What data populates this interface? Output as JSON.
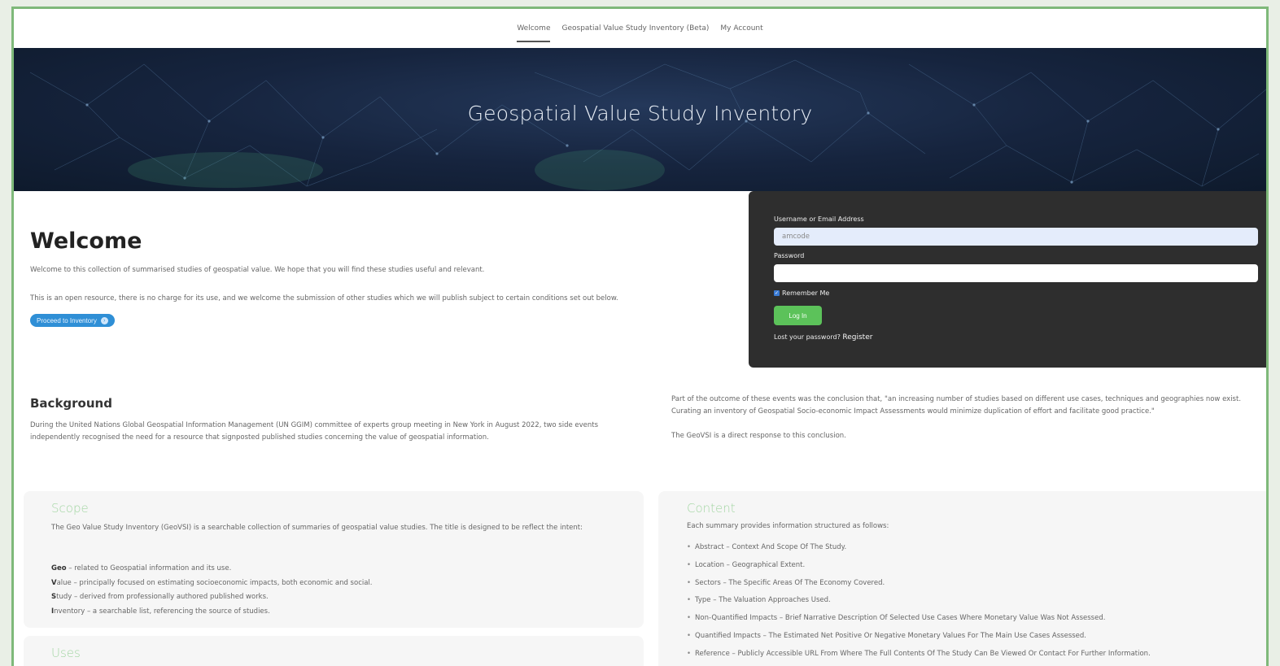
{
  "nav": {
    "items": [
      "Welcome",
      "Geospatial Value Study Inventory (Beta)",
      "My Account"
    ],
    "active": "Welcome"
  },
  "hero": {
    "title": "Geospatial Value Study Inventory"
  },
  "welcome": {
    "title": "Welcome",
    "p1": "Welcome to this collection of summarised studies of geospatial value. We hope that you will find these studies useful and relevant.",
    "p2": "This is an open resource, there is no charge for its use, and we welcome the submission of other studies which we will publish subject to certain conditions set out below.",
    "proceed_label": "Proceed to Inventory",
    "proceed_icon": "arrow-circle-icon"
  },
  "login": {
    "username_label": "Username or Email Address",
    "username_value": "amcode",
    "password_label": "Password",
    "remember_label": "Remember Me",
    "remember_checked": true,
    "submit_label": "Log In",
    "lost_label": "Lost your password?",
    "register_label": "Register"
  },
  "background": {
    "title": "Background",
    "text": "During the United Nations Global Geospatial Information Management (UN GGIM) committee of experts group meeting in New York in August 2022, two side events independently recognised the need for a resource that signposted published studies concerning the value of geospatial information.",
    "right_text": "Part of the outcome of these events was the conclusion that, \"an increasing number of studies based on different use cases, techniques and geographies now exist. Curating an inventory of Geospatial Socio-economic Impact Assessments would minimize duplication of effort and facilitate good practice.\"",
    "right_text2": "The GeoVSI is a direct response to this conclusion."
  },
  "scope": {
    "title": "Scope",
    "text": "The Geo Value Study Inventory (GeoVSI) is a searchable collection of summaries of geospatial value studies.  The title is designed to be reflect the intent:",
    "items": [
      {
        "key": "Geo",
        "rest": " – related to Geospatial information and its use."
      },
      {
        "key": "V",
        "rest": "alue – principally focused on estimating socioeconomic impacts, both economic and social."
      },
      {
        "key": "S",
        "rest": "tudy – derived from professionally authored published works."
      },
      {
        "key": "I",
        "rest": "nventory – a searchable list, referencing the source of studies."
      }
    ]
  },
  "uses": {
    "title": "Uses"
  },
  "content": {
    "title": "Content",
    "intro": "Each summary provides information structured as follows:",
    "items": [
      "Abstract – Context And Scope Of The Study.",
      "Location – Geographical Extent.",
      "Sectors – The Specific Areas Of The Economy Covered.",
      "Type – The Valuation Approaches Used.",
      "Non-Quantified Impacts – Brief Narrative Description Of Selected Use Cases Where Monetary Value Was Not Assessed.",
      "Quantified Impacts – The Estimated Net Positive Or Negative Monetary Values For The Main Use Cases Assessed.",
      "Reference – Publicly Accessible URL From Where The Full Contents Of The Study Can Be Viewed Or Contact For Further Information."
    ]
  }
}
